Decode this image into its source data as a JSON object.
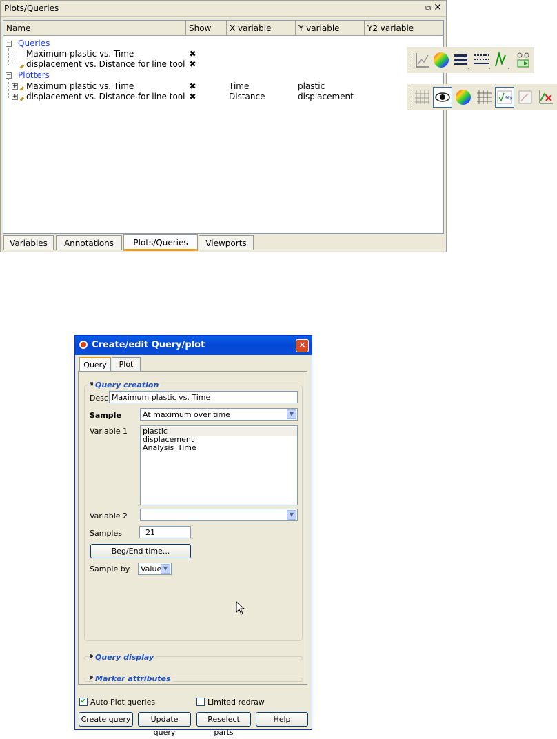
{
  "panel": {
    "title": "Plots/Queries",
    "float_icon": "⧉",
    "close_icon": "✕",
    "columns": [
      "Name",
      "Show",
      "X variable",
      "Y variable",
      "Y2 variable"
    ],
    "groups": [
      {
        "label": "Queries",
        "expander": "−",
        "items": [
          {
            "name": "Maximum plastic vs. Time",
            "show": "✖",
            "x": "",
            "y": ""
          },
          {
            "name": "displacement vs. Distance for line tool",
            "show": "✖",
            "x": "",
            "y": ""
          }
        ]
      },
      {
        "label": "Plotters",
        "expander": "−",
        "items": [
          {
            "name": "Maximum plastic vs. Time",
            "show": "✖",
            "x": "Time",
            "y": "plastic",
            "expander": "+"
          },
          {
            "name": "displacement vs. Distance for line tool",
            "show": "✖",
            "x": "Distance",
            "y": "displacement",
            "expander": "+"
          }
        ]
      }
    ],
    "tabs": [
      "Variables",
      "Annotations",
      "Plots/Queries",
      "Viewports"
    ],
    "active_tab": "Plots/Queries"
  },
  "toolbar1": {
    "icons": [
      "line-chart-icon",
      "color-wheel-icon",
      "line-width-icon",
      "line-style-icon",
      "marker-style-icon",
      "query-tool-icon"
    ]
  },
  "toolbar2": {
    "icons": [
      "grid-icon",
      "eye-icon",
      "color-wheel-icon",
      "grid-lines-icon",
      "legend-key-icon",
      "plot-frame-icon",
      "axis-swap-icon"
    ],
    "key_label": "Key"
  },
  "dialog": {
    "title": "Create/edit Query/plot",
    "close_icon": "✕",
    "tabs": [
      "Query",
      "Plot"
    ],
    "active_tab": "Query",
    "query_creation": {
      "title": "Query creation",
      "desc_label": "Desc",
      "desc_value": "Maximum plastic vs. Time",
      "sample_label": "Sample",
      "sample_value": "At maximum over time",
      "variable1_label": "Variable  1",
      "variable1_options": [
        "plastic",
        "displacement",
        "Analysis_Time"
      ],
      "variable2_label": "Variable  2",
      "variable2_value": "",
      "samples_label": "Samples",
      "samples_value": "21",
      "begend_button": "Beg/End time...",
      "sampleby_label": "Sample by",
      "sampleby_value": "Value"
    },
    "query_display": {
      "title": "Query display"
    },
    "marker_attributes": {
      "title": "Marker attributes"
    },
    "auto_plot": {
      "label": "Auto Plot queries",
      "checked": true
    },
    "limited_redraw": {
      "label": "Limited redraw",
      "checked": false
    },
    "buttons": {
      "create": "Create query",
      "update": "Update query",
      "reselect": "Reselect parts",
      "help": "Help"
    }
  }
}
